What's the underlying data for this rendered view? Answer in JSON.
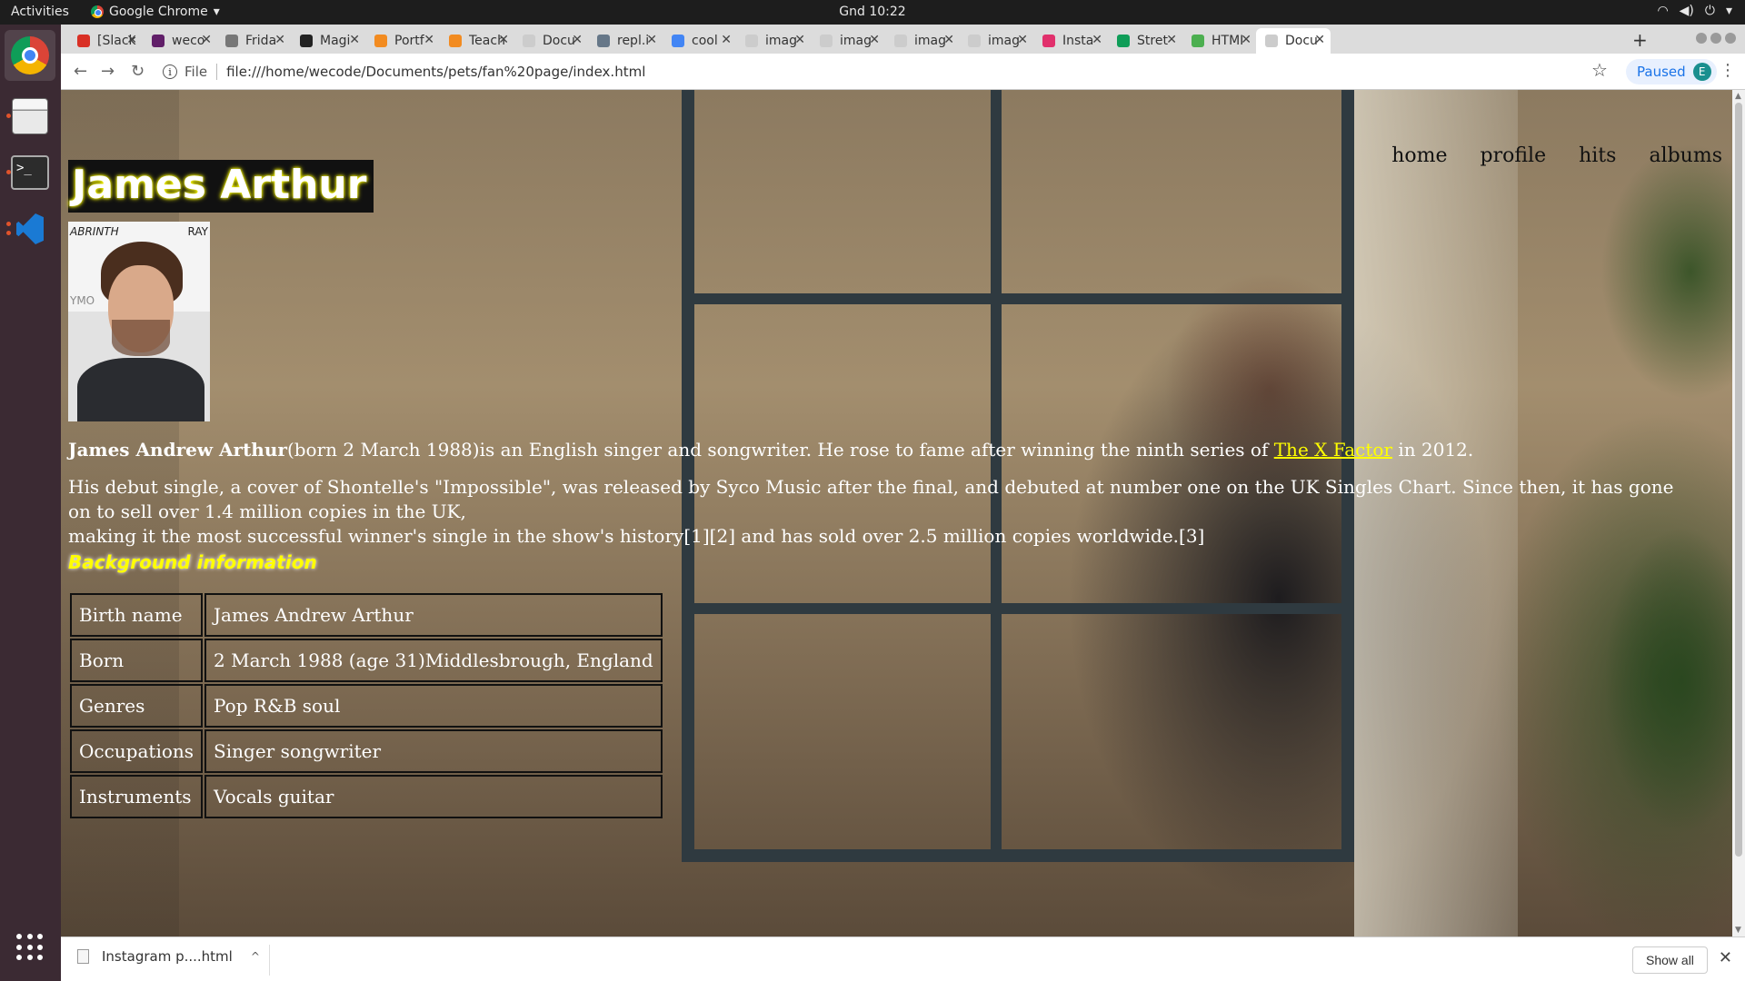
{
  "topbar": {
    "activities": "Activities",
    "app_name": "Google Chrome",
    "clock": "Gnd 10:22"
  },
  "tabs": [
    {
      "label": "[Slack",
      "icon_color": "#d93025"
    },
    {
      "label": "weco",
      "icon_color": "#611f69"
    },
    {
      "label": "Frida",
      "icon_color": "#777777"
    },
    {
      "label": "Magi",
      "icon_color": "#222222"
    },
    {
      "label": "Portf",
      "icon_color": "#f28b20"
    },
    {
      "label": "Teach",
      "icon_color": "#f28b20"
    },
    {
      "label": "Docu",
      "icon_color": "#cccccc"
    },
    {
      "label": "repl.i",
      "icon_color": "#667788"
    },
    {
      "label": "cool",
      "icon_color": "#4285f4"
    },
    {
      "label": "imag",
      "icon_color": "#cccccc"
    },
    {
      "label": "imag",
      "icon_color": "#cccccc"
    },
    {
      "label": "imag",
      "icon_color": "#cccccc"
    },
    {
      "label": "imag",
      "icon_color": "#cccccc"
    },
    {
      "label": "Insta",
      "icon_color": "#e1306c"
    },
    {
      "label": "Stret",
      "icon_color": "#0f9d58"
    },
    {
      "label": "HTMI",
      "icon_color": "#4caf50"
    },
    {
      "label": "Docu",
      "icon_color": "#cccccc",
      "active": true
    }
  ],
  "address_bar": {
    "scheme_label": "File",
    "url": "file:///home/wecode/Documents/pets/fan%20page/index.html",
    "profile_status": "Paused",
    "profile_initial": "E"
  },
  "page": {
    "nav": [
      "home",
      "profile",
      "hits",
      "albums"
    ],
    "title": "James Arthur",
    "intro": {
      "name": "James Andrew Arthur",
      "text_a": "(born 2 March 1988)is an English singer and songwriter. He rose to fame after winning the ninth series of ",
      "link": "The X Factor",
      "text_b": " in 2012."
    },
    "para2_line1": "His debut single, a cover of Shontelle's \"Impossible\", was released by Syco Music after the final, and debuted at number one on the UK Singles Chart. Since then, it has gone on to sell over 1.4 million copies in the UK,",
    "para2_line2": "making it the most successful winner's single in the show's history[1][2] and has sold over 2.5 million copies worldwide.[3]",
    "section_heading": "Background information",
    "info_table": [
      {
        "key": "Birth name",
        "value": "James Andrew Arthur"
      },
      {
        "key": "Born",
        "value": "2 March 1988 (age 31)Middlesbrough, England"
      },
      {
        "key": "Genres",
        "value": "Pop R&B soul"
      },
      {
        "key": "Occupations",
        "value": "Singer songwriter"
      },
      {
        "key": "Instruments",
        "value": "Vocals guitar"
      }
    ],
    "portrait_logos": [
      "ABRINTH",
      "RAY",
      "YMO"
    ]
  },
  "downloads": {
    "file": "Instagram p....html",
    "show_all": "Show all"
  },
  "colors": {
    "accent_yellow": "#ffff00",
    "dock_bg": "#3b2a33",
    "tabstrip_bg": "#dcdcdc"
  }
}
